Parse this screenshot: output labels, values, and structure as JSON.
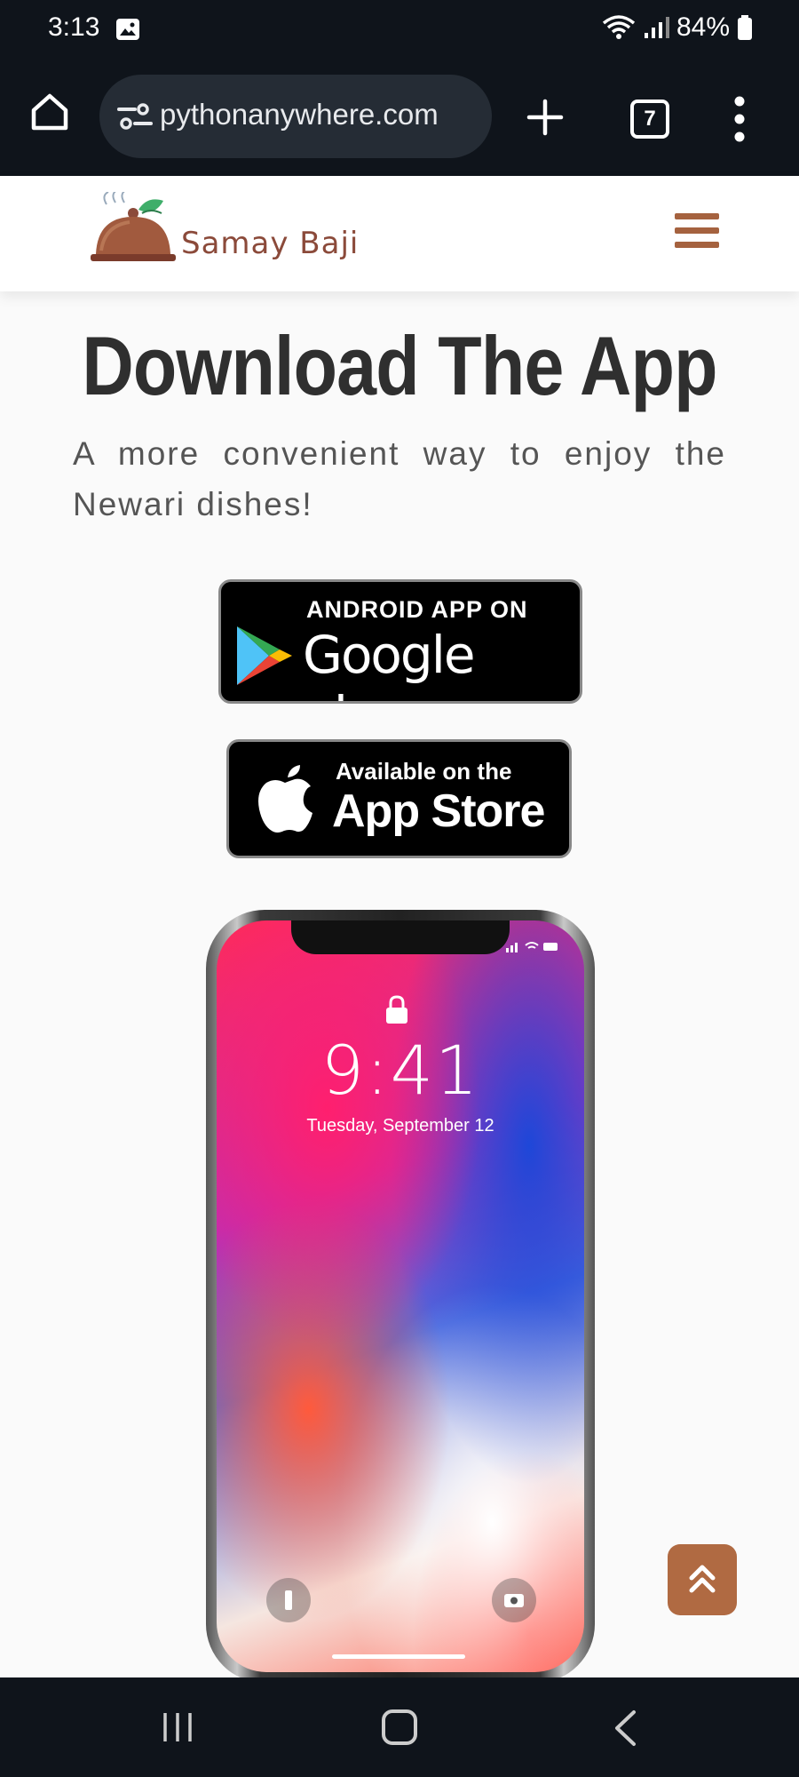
{
  "status_bar": {
    "time": "3:13",
    "battery": "84%",
    "icons": [
      "gallery-icon",
      "wifi-icon",
      "signal-icon",
      "battery-icon"
    ]
  },
  "browser": {
    "url": "pythonanywhere.com",
    "tab_count": "7",
    "icons": [
      "home-icon",
      "site-settings-icon",
      "new-tab-icon",
      "tabs-icon",
      "more-menu-icon"
    ]
  },
  "site": {
    "brand": "Samay Baji",
    "brand_color": "#8b4a3a",
    "accent_color": "#b06a42",
    "menu_icon": "hamburger-icon"
  },
  "main": {
    "headline": "Download The App",
    "tagline": "A more convenient way to enjoy the Newari dishes!",
    "google_badge": {
      "top": "ANDROID APP ON",
      "bottom": "Google play"
    },
    "apple_badge": {
      "top": "Available on the",
      "bottom": "App Store"
    },
    "phone_mockup": {
      "time": "9:41",
      "date": "Tuesday, September 12"
    }
  },
  "scroll_top_icon": "double-chevron-up-icon",
  "nav_bar": {
    "icons": [
      "recent-apps-icon",
      "home-button-icon",
      "back-icon"
    ]
  }
}
